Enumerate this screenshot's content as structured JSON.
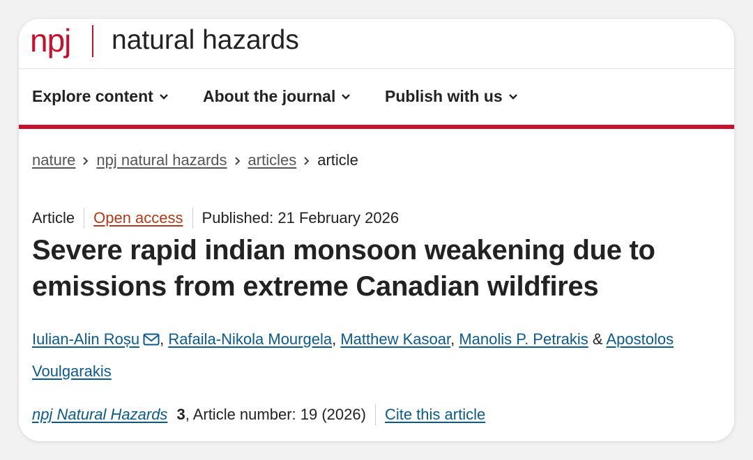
{
  "header": {
    "brand_short": "npj",
    "brand_name": "natural hazards"
  },
  "nav": {
    "items": [
      {
        "label": "Explore content"
      },
      {
        "label": "About the journal"
      },
      {
        "label": "Publish with us"
      }
    ],
    "icon": "chevron-down-icon"
  },
  "breadcrumb": {
    "items": [
      "nature",
      "npj natural hazards",
      "articles"
    ],
    "current": "article"
  },
  "article": {
    "type": "Article",
    "access": "Open access",
    "published": "Published: 21 February 2026",
    "title": "Severe rapid indian monsoon weakening due to emissions from extreme Canadian wildfires",
    "authors": [
      {
        "name": "Iulian-Alin Roșu",
        "sep": ", "
      },
      {
        "name": "Rafaila-Nikola Mourgela",
        "sep": ", "
      },
      {
        "name": "Matthew Kasoar",
        "sep": ", "
      },
      {
        "name": "Manolis P. Petrakis",
        "sep": " & "
      },
      {
        "name": "Apostolos Voulgarakis",
        "sep": ""
      }
    ],
    "journal": "npj Natural Hazards",
    "volume": "3",
    "article_number": ", Article number: 19 (2026)",
    "cite_label": "Cite this article"
  },
  "colors": {
    "brand_red": "#c8102e",
    "link_blue": "#0c5a8a",
    "open_access": "#b03a1a"
  }
}
